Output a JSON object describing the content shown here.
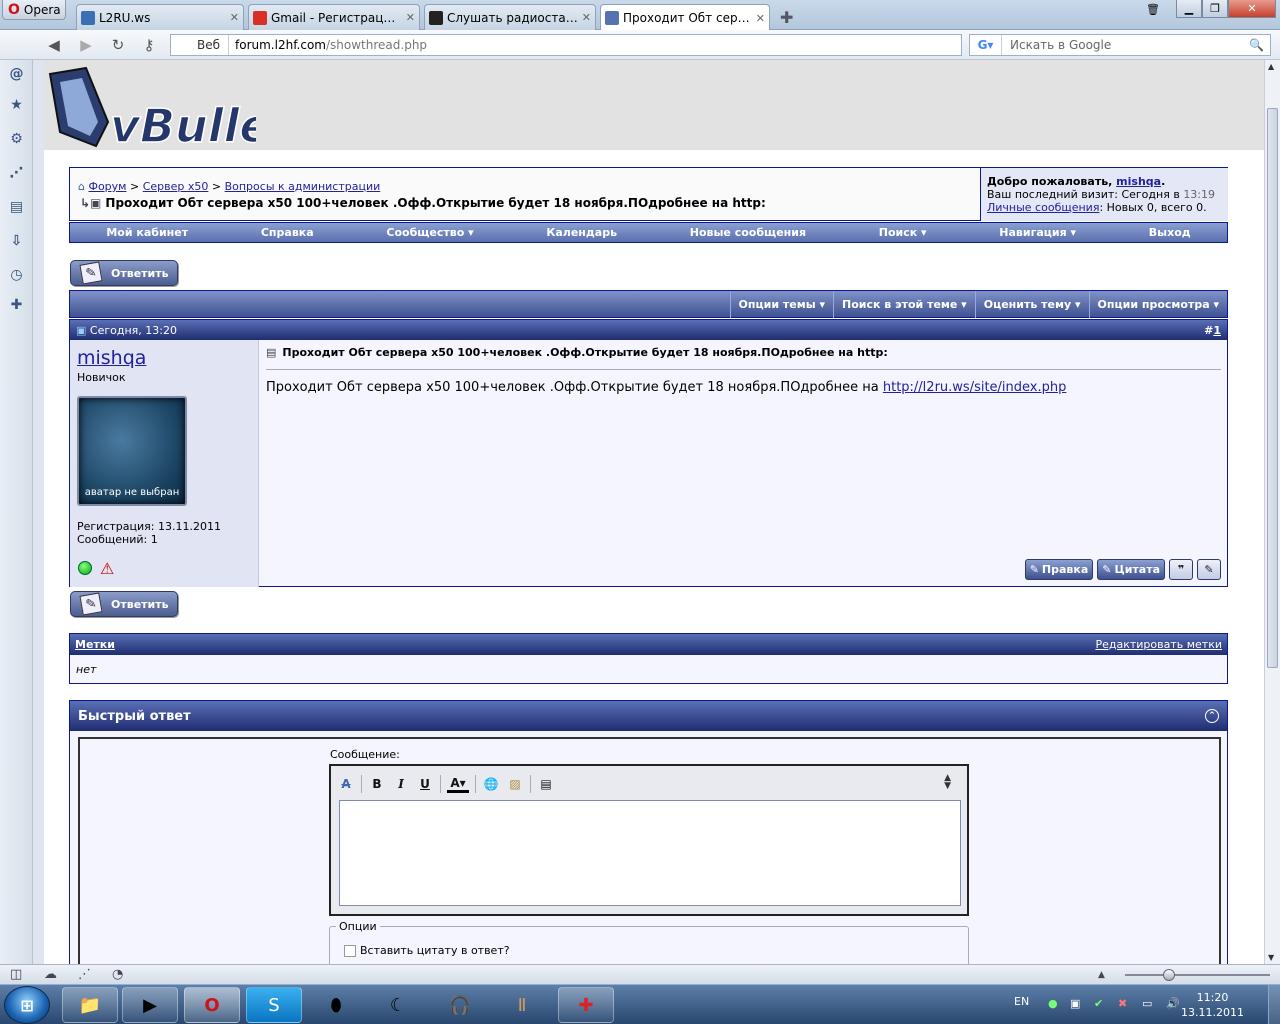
{
  "browser": {
    "menu_label": "Opera",
    "tabs": [
      {
        "label": "L2RU.ws",
        "color": "#3b6fb6",
        "active": false
      },
      {
        "label": "Gmail - Регистрация н...",
        "color": "#d93025",
        "active": false
      },
      {
        "label": "Слушать радиостанци...",
        "color": "#222222",
        "active": false
      },
      {
        "label": "Проходит Обт сервер...",
        "color": "#5573b0",
        "active": true
      }
    ],
    "new_tab_icon": "plus-icon",
    "address": {
      "zone_label": "Веб",
      "url_domain": "forum.l2hf.com",
      "url_path": "/showthread.php"
    },
    "search": {
      "placeholder": "Искать в Google",
      "engine": "G"
    }
  },
  "forum": {
    "logo_text": "vBulletin",
    "breadcrumb": [
      "Форум",
      "Сервер x50",
      "Вопросы к администрации"
    ],
    "thread_title": "Проходит Обт сервера x50 100+человек .Офф.Открытие будет 18 ноября.ПОдробнее на http:",
    "welcome": {
      "greeting": "Добро пожаловать, ",
      "username": "mishqa",
      "last_visit_label": "Ваш последний визит: Сегодня в ",
      "last_visit_time": "13:19",
      "pm_label": "Личные сообщения",
      "pm_status": ": Новых 0, всего 0."
    },
    "navbar": [
      "Мой кабинет",
      "Справка",
      "Сообщество ▾",
      "Календарь",
      "Новые сообщения",
      "Поиск ▾",
      "Навигация ▾",
      "Выход"
    ],
    "reply_button": "Ответить",
    "thread_tools": [
      "Опции темы ▾",
      "Поиск в этой теме ▾",
      "Оценить тему ▾",
      "Опции просмотра ▾"
    ],
    "post": {
      "date": "Сегодня, 13:20",
      "number_prefix": "#",
      "number": "1",
      "username": "mishqa",
      "rank": "Новичок",
      "avatar_text": "аватар не выбран",
      "reg": "Регистрация: 13.11.2011",
      "posts": "Сообщений: 1",
      "title": "Проходит Обт сервера x50 100+человек .Офф.Открытие будет 18 ноября.ПОдробнее на http:",
      "body_text": "Проходит Обт сервера x50 100+человек .Офф.Открытие будет 18 ноября.ПОдробнее на ",
      "body_link": "http://l2ru.ws/site/index.php",
      "edit_btn": "Правка",
      "quote_btn": "Цитата"
    },
    "tags": {
      "title": "Метки",
      "edit": "Редактировать метки",
      "value": "нет"
    },
    "quick_reply": {
      "title": "Быстрый ответ",
      "message_label": "Сообщение:",
      "options_legend": "Опции",
      "quote_option": "Вставить цитату в ответ?"
    }
  },
  "taskbar": {
    "lang": "EN",
    "time": "11:20",
    "date": "13.11.2011"
  }
}
